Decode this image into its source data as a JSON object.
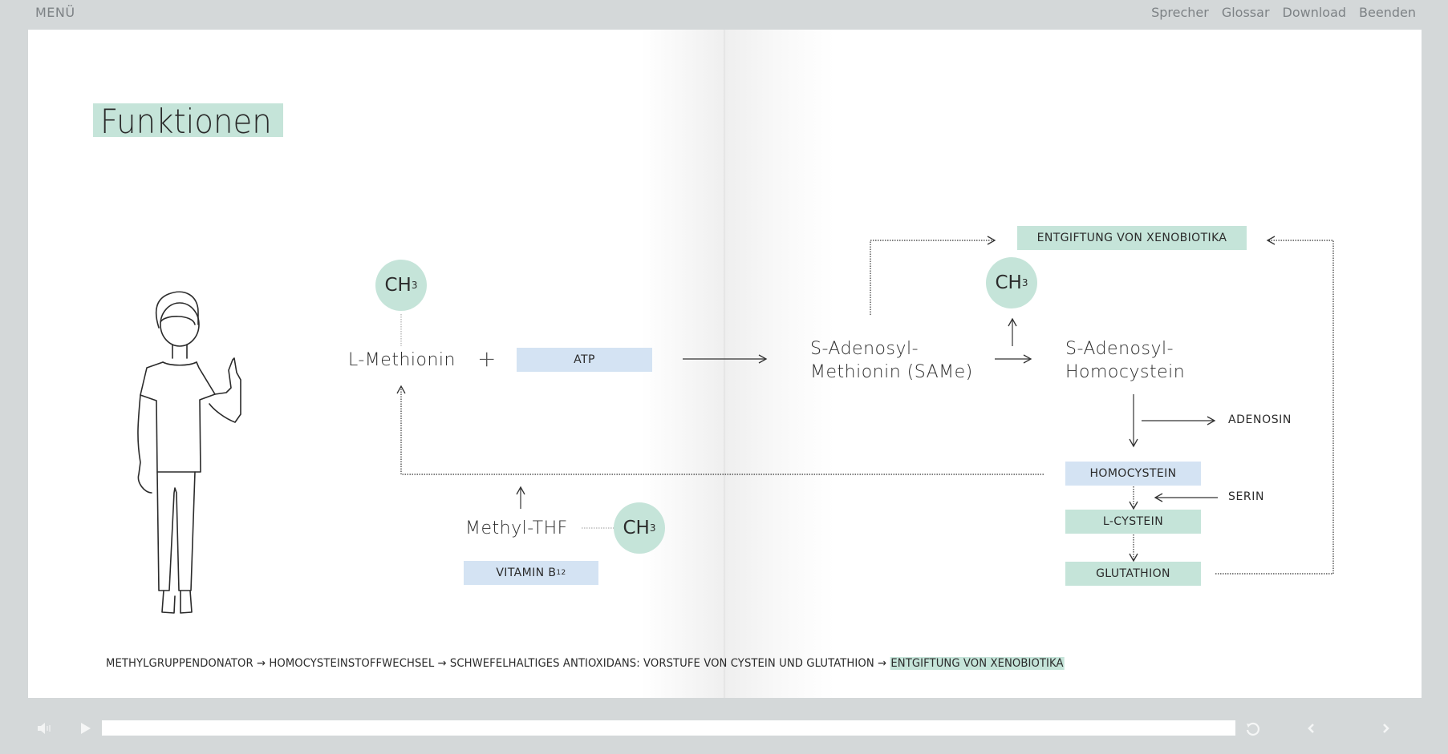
{
  "topbar": {
    "menu_label": "MENÜ",
    "nav": [
      "Sprecher",
      "Glossar",
      "Download",
      "Beenden"
    ]
  },
  "page": {
    "title": "Funktionen",
    "diagram": {
      "l_methionin": "L-Methionin",
      "plus": "+",
      "atp": "ATP",
      "ch3_main": "CH",
      "ch3_sub": "3",
      "same_line1": "S-Adenosyl-",
      "same_line2": "Methionin (SAMe)",
      "sah_line1": "S-Adenosyl-",
      "sah_line2": "Homocystein",
      "entgiftung": "ENTGIFTUNG VON XENOBIOTIKA",
      "adenosin": "ADENOSIN",
      "homocystein": "HOMOCYSTEIN",
      "serin": "SERIN",
      "l_cystein": "L-CYSTEIN",
      "glutathion": "GLUTATHION",
      "methyl_thf": "Methyl-THF",
      "vitamin_main": "VITAMIN B",
      "vitamin_sub": "12"
    },
    "summary": {
      "text": "METHYLGRUPPENDONATOR → HOMOCYSTEINSTOFFWECHSEL →  SCHWEFELHALTIGES ANTIOXIDANS: VORSTUFE VON CYSTEIN UND GLUTATHION → ",
      "highlight": "ENTGIFTUNG VON XENOBIOTIKA"
    }
  },
  "player": {
    "volume_icon": "speaker-icon",
    "play_icon": "play-icon",
    "progress": 0,
    "replay_icon": "replay-icon",
    "prev_icon": "chevron-left-icon",
    "next_icon": "chevron-right-icon"
  },
  "colors": {
    "green": "#c5e4d9",
    "blue": "#d4e3f3",
    "chrome": "#d4d8d9"
  }
}
